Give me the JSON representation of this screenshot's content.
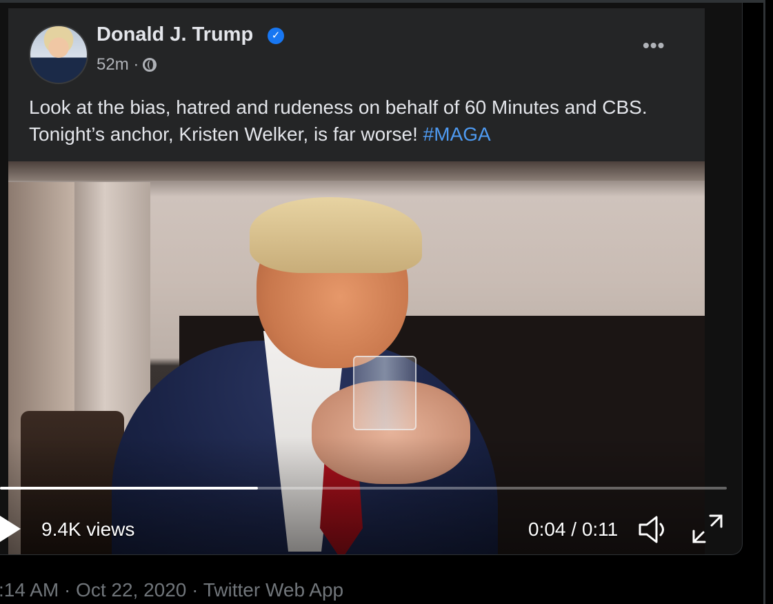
{
  "post": {
    "author": "Donald J. Trump",
    "time": "52m ·",
    "text": "Look at the bias, hatred and rudeness on behalf of 60 Minutes and CBS. Tonight’s anchor, Kristen Welker, is far worse! ",
    "hashtag": "#MAGA",
    "more": "•••"
  },
  "video": {
    "views": "9.4K views",
    "time": "0:04 / 0:11",
    "progress_fraction": 0.355
  },
  "tweet": {
    "meta": ":14 AM · Oct 22, 2020 · Twitter Web App"
  },
  "icons": {
    "play": "play-icon",
    "volume": "volume-icon",
    "fullscreen": "fullscreen-icon",
    "verified": "verified-badge-icon",
    "globe": "globe-icon"
  },
  "colors": {
    "facebook_link": "#4e9af1",
    "verified_blue": "#1877f2",
    "twitter_meta": "#71767b"
  }
}
